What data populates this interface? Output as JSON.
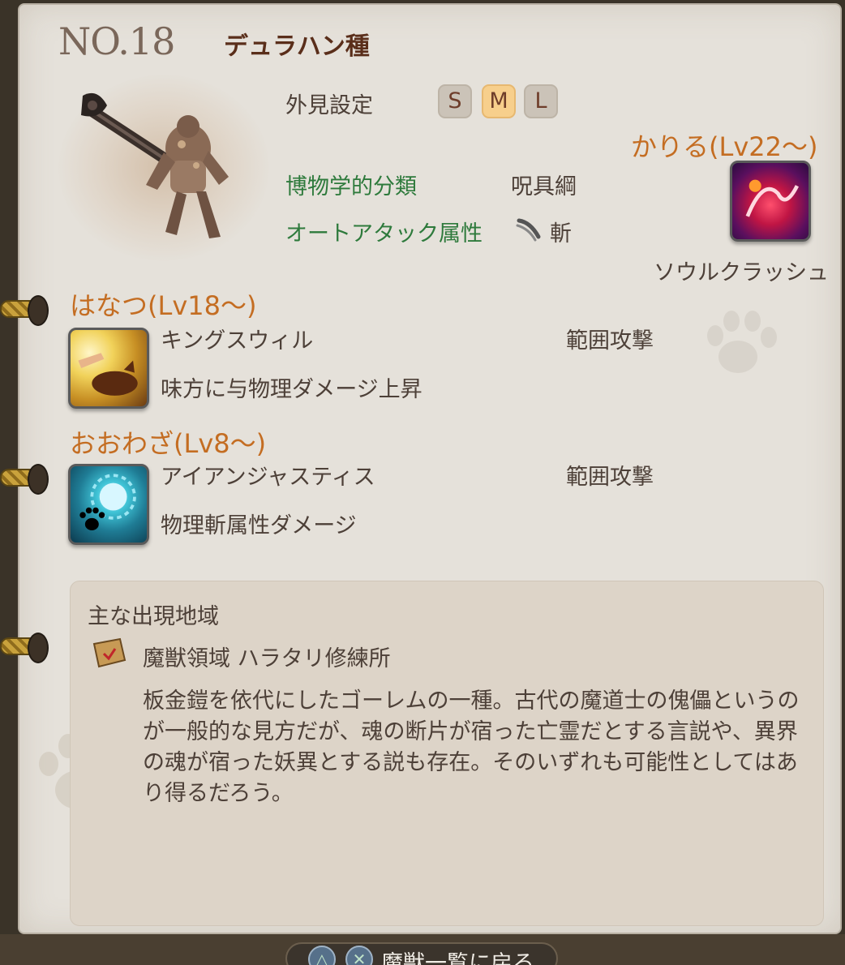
{
  "header": {
    "number": "NO.18",
    "species": "デュラハン種"
  },
  "appearance": {
    "label": "外見設定",
    "sizes": [
      "S",
      "M",
      "L"
    ],
    "selected": "M"
  },
  "classification": {
    "label": "博物学的分類",
    "value": "呪具綱"
  },
  "auto_attack": {
    "label": "オートアタック属性",
    "value": "斬",
    "icon": "slash-icon"
  },
  "kariru": {
    "title": "かりる(Lv22～)",
    "skill_name": "ソウルクラッシュ",
    "icon": "soul-crush-icon"
  },
  "hanatsu": {
    "title": "はなつ(Lv18～)",
    "skill_name": "キングスウィル",
    "type": "範囲攻撃",
    "description": "味方に与物理ダメージ上昇",
    "icon": "kings-will-icon"
  },
  "oowaza": {
    "title": "おおわざ(Lv8～)",
    "skill_name": "アイアンジャスティス",
    "type": "範囲攻撃",
    "description": "物理斬属性ダメージ",
    "icon": "iron-justice-icon"
  },
  "habitat": {
    "title": "主な出現地域",
    "area": "魔獣領域 ハラタリ修練所",
    "description": "板金鎧を依代にしたゴーレムの一種。古代の魔道士の傀儡というのが一般的な見方だが、魂の断片が宿った亡霊だとする言説や、異界の魂が宿った妖異とする説も存在。そのいずれも可能性としてはあり得るだろう。"
  },
  "footer": {
    "back_label": "魔獣一覧に戻る",
    "buttons": [
      "△",
      "✕"
    ]
  },
  "colors": {
    "section_title": "#c46d22",
    "green_label": "#2e7a3c",
    "selected_size": "#f7cf8c"
  }
}
